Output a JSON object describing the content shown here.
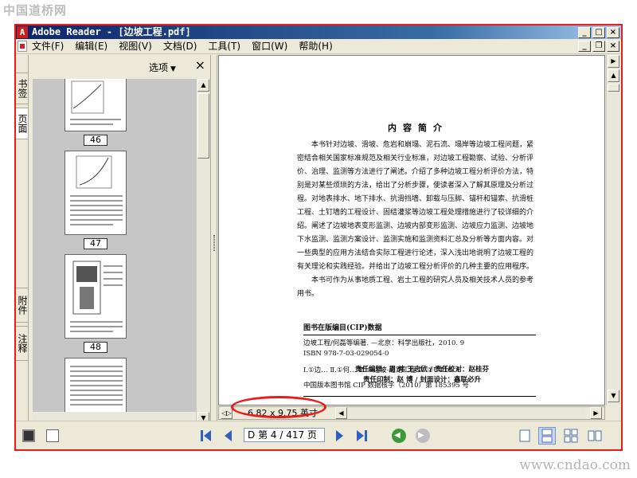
{
  "watermarks": {
    "top_left": "中国道桥网",
    "bottom_right": "www.cndao.com"
  },
  "window": {
    "title": "Adobe Reader - [边坡工程.pdf]",
    "controls": {
      "minimize": "_",
      "maximize": "□",
      "close": "×"
    },
    "doc_controls": {
      "minimize": "_",
      "restore": "❐",
      "close": "×"
    }
  },
  "menu": [
    "文件(F)",
    "编辑(E)",
    "视图(V)",
    "文档(D)",
    "工具(T)",
    "窗口(W)",
    "帮助(H)"
  ],
  "side_tabs": [
    "书签",
    "页面",
    "附件",
    "注释"
  ],
  "nav_panel": {
    "options_label": "选项",
    "close": "×",
    "thumbnail_labels": [
      "46",
      "47",
      "48"
    ]
  },
  "document": {
    "heading": "内容简介",
    "paragraphs": [
      "本书针对边坡、滑坡、危岩和崩塌、泥石流、塌岸等边坡工程问题，紧密结合相关国家标准规范及相关行业标准，对边坡工程勘察、试验、分析评价、治理、监测等方法进行了阐述。介绍了多种边坡工程分析评价方法，特别是对某些烦琐的方法，给出了分析步骤，使读者深入了解其原理及分析过程。对地表排水、地下排水、抗滑挡墙、卸载与压脚、锚杆和锚索、抗滑桩工程、土钉墙的工程设计、固结灌浆等边坡工程处理措施进行了较详细的介绍。阐述了边坡地表变形监测、边坡内部变形监测、边坡应力监测、边坡地下水监测、监测方案设计、监测实施和监测资料汇总及分析等方面内容。对一些典型的应用方法结合实际工程进行论述，深入浅出地说明了边坡工程的有关理论和实践经验。并给出了边坡工程分析评价的几种主要的应用程序。",
      "本书可作为从事地质工程、岩土工程的研究人员及相关技术人员的参考用书。"
    ],
    "cip": {
      "title": "图书在版编目(CIP)数据",
      "lines": [
        "边坡工程/何磊等编著. —北京：科学出版社，2010. 9",
        "ISBN 978-7-03-029054-0",
        "Ⅰ.①边…  Ⅱ.①何…  Ⅲ.①边坡-道路工程  Ⅳ.①U416. 1",
        "中国版本图书馆 CIP 数据核字（2010）第 185395 号"
      ]
    },
    "credits": [
      "责任编辑：周  炜  王志欣 / 责任校对：赵桂芬",
      "责任印制：赵  博 / 封面设计：鑫联必升"
    ]
  },
  "status": {
    "page_size": "6.82 x 9.75 英寸"
  },
  "bottom_nav": {
    "page_field_prefix": "D",
    "page_field": "第 4 / 417 页",
    "highlight_color": "#e81c1c"
  },
  "colors": {
    "titlebar_start": "#0a246a",
    "titlebar_end": "#a6caf0",
    "chrome": "#ece9d8",
    "border_highlight": "#e81c1c"
  }
}
